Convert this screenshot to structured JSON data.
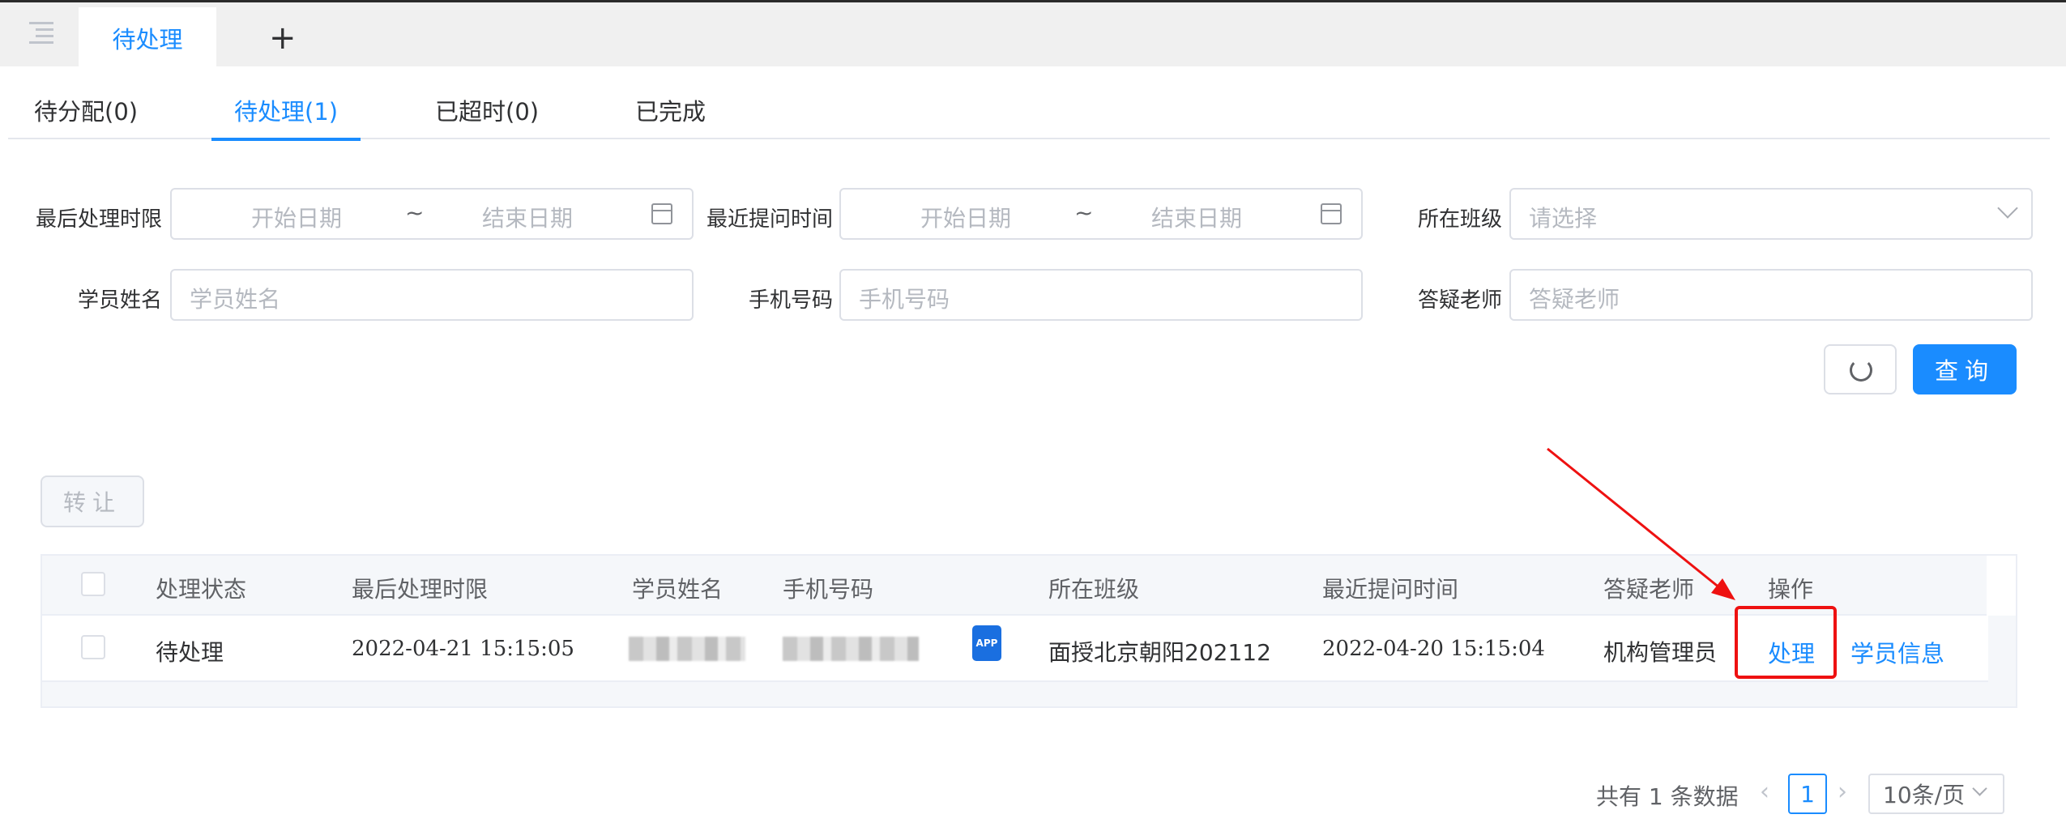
{
  "header": {
    "active_tab": "待处理",
    "add_tab_icon": "plus-icon",
    "menu_icon": "menu-fold-icon"
  },
  "status_tabs": [
    {
      "label": "待分配(0)"
    },
    {
      "label": "待处理(1)",
      "active": true
    },
    {
      "label": "已超时(0)"
    },
    {
      "label": "已完成"
    }
  ],
  "filters": {
    "last_handle_label": "最后处理时限",
    "last_handle_start": "开始日期",
    "last_handle_sep": "~",
    "last_handle_end": "结束日期",
    "recent_ask_label": "最近提问时间",
    "recent_ask_start": "开始日期",
    "recent_ask_sep": "~",
    "recent_ask_end": "结束日期",
    "class_label": "所在班级",
    "class_placeholder": "请选择",
    "student_label": "学员姓名",
    "student_placeholder": "学员姓名",
    "phone_label": "手机号码",
    "phone_placeholder": "手机号码",
    "teacher_label": "答疑老师",
    "teacher_placeholder": "答疑老师"
  },
  "buttons": {
    "query": "查询",
    "transfer": "转让"
  },
  "table": {
    "columns": [
      "处理状态",
      "最后处理时限",
      "学员姓名",
      "手机号码",
      "所在班级",
      "最近提问时间",
      "答疑老师",
      "操作"
    ],
    "rows": [
      {
        "status": "待处理",
        "deadline": "2022-04-21 15:15:05",
        "class": "面授北京朝阳202112",
        "recent_ask": "2022-04-20 15:15:04",
        "teacher": "机构管理员",
        "app_badge": "APP",
        "actions": [
          "处理",
          "学员信息"
        ]
      }
    ]
  },
  "pagination": {
    "total_text": "共有 1 条数据",
    "current_page": "1",
    "page_size": "10条/页"
  },
  "colors": {
    "accent": "#1a8cff",
    "annotation": "#ee1111"
  }
}
